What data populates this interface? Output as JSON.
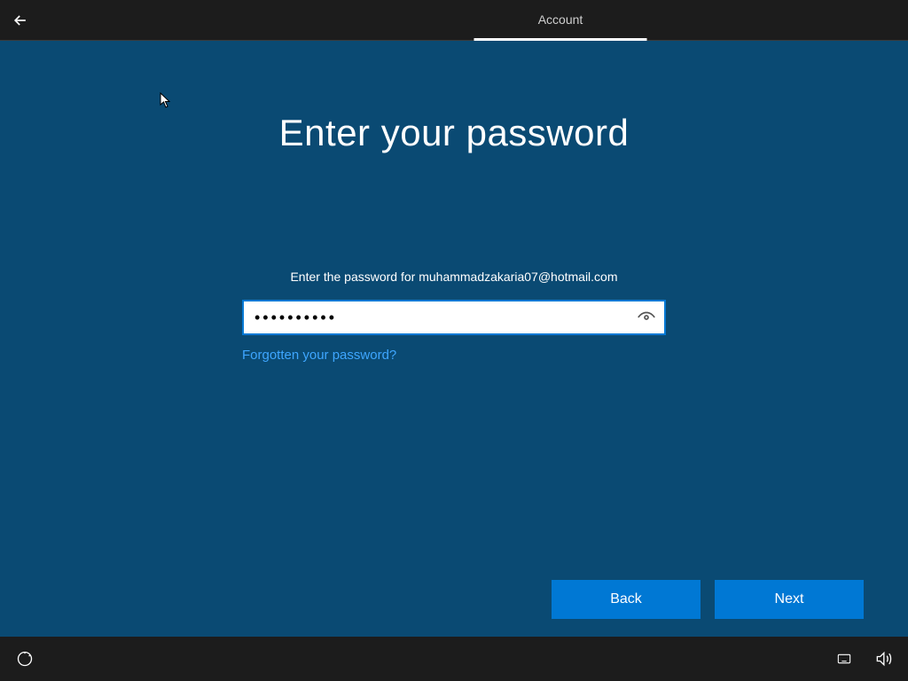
{
  "header": {
    "tab_label": "Account"
  },
  "main": {
    "heading": "Enter your password",
    "subtext": "Enter the password for muhammadzakaria07@hotmail.com",
    "password_value": "••••••••••",
    "forgot_link": "Forgotten your password?"
  },
  "buttons": {
    "back": "Back",
    "next": "Next"
  }
}
